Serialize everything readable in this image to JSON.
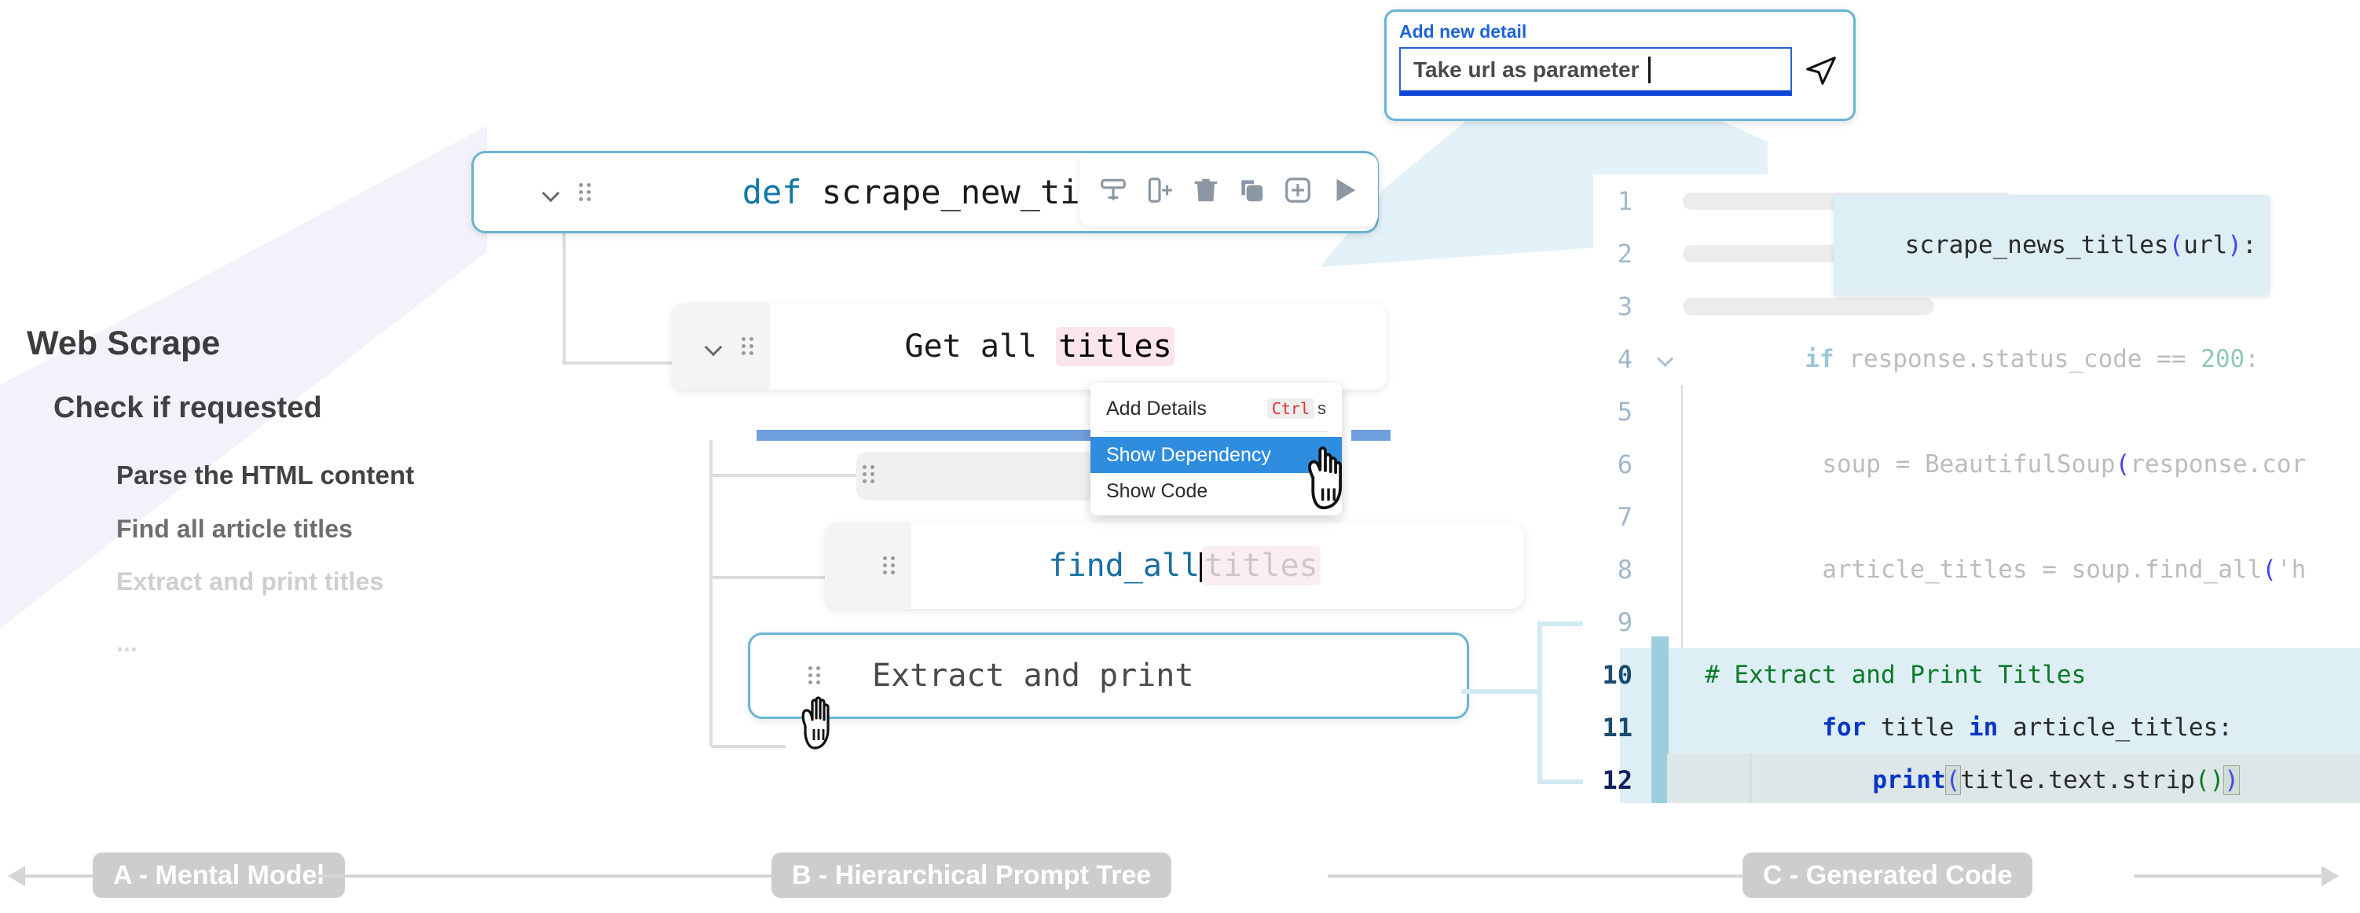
{
  "mental_model": {
    "items": [
      {
        "label": "Web Scrape",
        "level": 0
      },
      {
        "label": "Check if requested",
        "level": 1
      },
      {
        "label": "Parse the HTML content",
        "level": 2
      },
      {
        "label": "Find all article titles",
        "level": 2
      },
      {
        "label": "Extract and print titles",
        "level": 2
      },
      {
        "label": "...",
        "level": 2
      }
    ]
  },
  "tree": {
    "nodes": [
      {
        "id": "node-def",
        "keyword": "def ",
        "text": "scrape_new_titles",
        "has_chevron": true,
        "has_grip": true,
        "selected": true
      },
      {
        "id": "node-get-all-titles",
        "text_plain": "Get all ",
        "text_highlight": "titles",
        "has_chevron": true,
        "has_grip": true
      },
      {
        "id": "node-find-all",
        "text_code": "find_all",
        "suggestion": "titles",
        "has_grip": true
      },
      {
        "id": "node-extract-print",
        "text_plain": "Extract and print",
        "has_grip": true,
        "selected": true
      }
    ]
  },
  "toolbar": {
    "icons": [
      {
        "name": "add-node-below-icon",
        "label": "Add node below"
      },
      {
        "name": "add-node-right-icon",
        "label": "Add node right"
      },
      {
        "name": "delete-node-icon",
        "label": "Delete"
      },
      {
        "name": "duplicate-node-icon",
        "label": "Duplicate"
      },
      {
        "name": "add-detail-icon",
        "label": "Add detail"
      },
      {
        "name": "run-icon",
        "label": "Run"
      }
    ]
  },
  "context_menu": {
    "items": [
      {
        "label": "Add Details",
        "shortcut_key": "Ctrl",
        "shortcut_rest": "s",
        "active": false
      },
      {
        "label": "Show Dependency",
        "active": true
      },
      {
        "label": "Show Code",
        "active": false
      }
    ]
  },
  "add_detail_popup": {
    "label": "Add new detail",
    "value": "Take url as parameter",
    "placeholder": "Add new detail",
    "send_icon": "send-icon"
  },
  "code_tooltip": {
    "text_plain": "scrape_news_titles",
    "text_paren_open": "(",
    "text_arg": "url",
    "text_paren_close": ")",
    "text_colon": ":"
  },
  "code_panel": {
    "lines": [
      {
        "number": "1",
        "type": "skeleton",
        "skeleton_width": 420
      },
      {
        "number": "2",
        "type": "skeleton",
        "skeleton_width": 360
      },
      {
        "number": "3",
        "type": "skeleton",
        "skeleton_width": 320
      },
      {
        "number": "4",
        "type": "code-faded",
        "fold": true,
        "text": "if response.status_code == 200:"
      },
      {
        "number": "5",
        "type": "blank"
      },
      {
        "number": "6",
        "type": "code-faded",
        "text": "soup = BeautifulSoup(response.cor"
      },
      {
        "number": "7",
        "type": "blank"
      },
      {
        "number": "8",
        "type": "code-faded",
        "text": "article_titles = soup.find_all('h"
      },
      {
        "number": "9",
        "type": "blank"
      },
      {
        "number": "10",
        "type": "code-highlight",
        "text": "# Extract and Print Titles"
      },
      {
        "number": "11",
        "type": "code-highlight",
        "text": "for title in article_titles:"
      },
      {
        "number": "12",
        "type": "code-highlight-active",
        "text": "print(title.text.strip())"
      }
    ]
  },
  "bottom_axis": {
    "labels": [
      {
        "id": "a",
        "text": "A - Mental Model"
      },
      {
        "id": "b",
        "text": "B - Hierarchical Prompt Tree"
      },
      {
        "id": "c",
        "text": "C - Generated Code"
      }
    ]
  },
  "colors": {
    "accent_blue": "#2f8de0",
    "node_border": "#6ab4d2",
    "highlight_pink": "#fae6ea",
    "code_highlight": "#ddeef4",
    "beam": "#daeef5",
    "beam_purple": "#f3f1fa"
  }
}
